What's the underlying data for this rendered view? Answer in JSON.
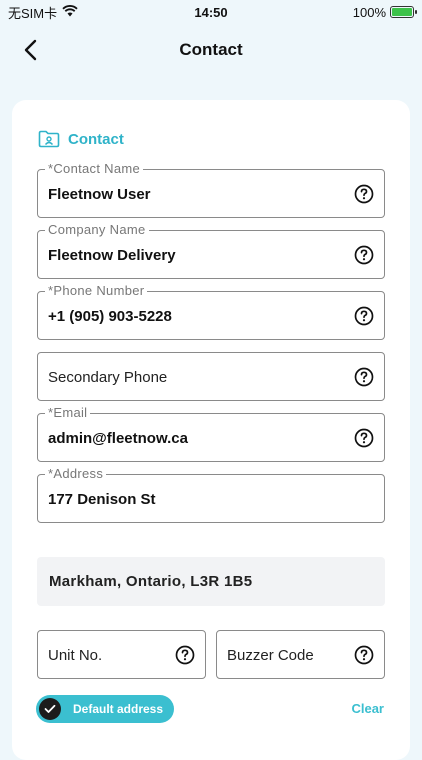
{
  "status_bar": {
    "carrier": "无SIM卡",
    "time": "14:50",
    "battery": "100%"
  },
  "nav": {
    "title": "Contact"
  },
  "section": {
    "title": "Contact"
  },
  "fields": {
    "contact_name": {
      "label": "*Contact Name",
      "value": "Fleetnow User"
    },
    "company_name": {
      "label": "Company Name",
      "value": "Fleetnow Delivery"
    },
    "phone_number": {
      "label": "*Phone Number",
      "value": "+1 (905) 903-5228"
    },
    "secondary_phone": {
      "placeholder": "Secondary Phone"
    },
    "email": {
      "label": "*Email",
      "value": "admin@fleetnow.ca"
    },
    "address": {
      "label": "*Address",
      "value": "177 Denison St"
    },
    "city_line": "Markham, Ontario, L3R 1B5",
    "unit_no": {
      "placeholder": "Unit No."
    },
    "buzzer_code": {
      "placeholder": "Buzzer Code"
    }
  },
  "actions": {
    "default_address": "Default address",
    "clear": "Clear"
  },
  "colors": {
    "accent": "#3bbfd0",
    "background": "#eef7fb"
  }
}
